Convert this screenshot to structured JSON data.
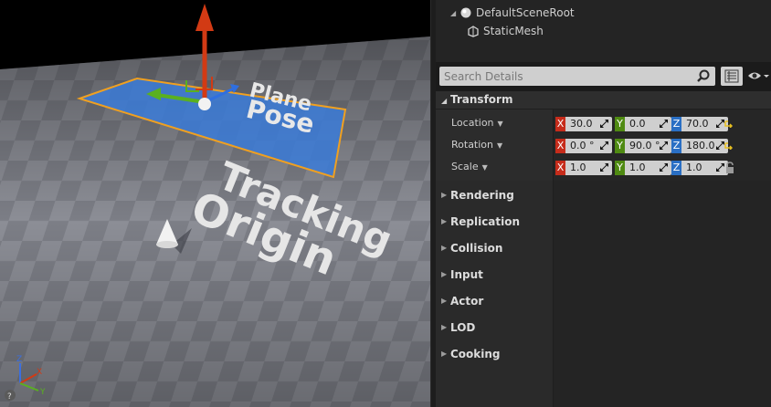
{
  "viewport": {
    "label_plane_pose_1": "Plane",
    "label_plane_pose_2": "Pose",
    "label_tracking_1": "Tracking",
    "label_tracking_2": "Origin",
    "axis_widget": {
      "x": "X",
      "y": "Y",
      "z": "Z"
    }
  },
  "components": {
    "root": "DefaultSceneRoot",
    "child": "StaticMesh"
  },
  "search": {
    "placeholder": "Search Details"
  },
  "transform": {
    "title": "Transform",
    "location": {
      "label": "Location",
      "x": "30.0",
      "y": "0.0",
      "z": "70.0"
    },
    "rotation": {
      "label": "Rotation",
      "x": "0.0 °",
      "y": "90.0 °",
      "z": "180.0"
    },
    "scale": {
      "label": "Scale",
      "x": "1.0",
      "y": "1.0",
      "z": "1.0"
    },
    "axis_tags": {
      "x": "X",
      "y": "Y",
      "z": "Z"
    }
  },
  "categories": [
    "Rendering",
    "Replication",
    "Collision",
    "Input",
    "Actor",
    "LOD",
    "Cooking"
  ],
  "colors": {
    "x_axis": "#c62c1b",
    "y_axis": "#4f8a12",
    "z_axis": "#2a6fc4",
    "selection": "#f0a020"
  }
}
